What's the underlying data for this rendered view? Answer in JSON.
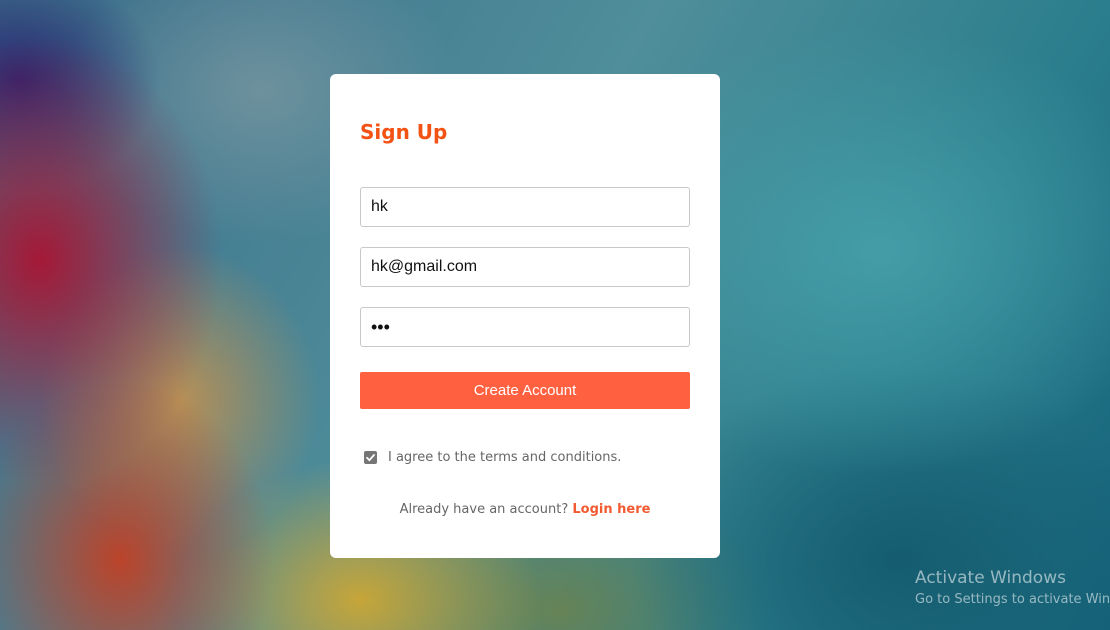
{
  "form": {
    "title": "Sign Up",
    "name_value": "hk",
    "email_value": "hk@gmail.com",
    "password_value": "abc",
    "submit_label": "Create Account",
    "terms_label": "I agree to the terms and conditions.",
    "terms_checked": true,
    "footer_text": "Already have an account?",
    "login_link": "Login here"
  },
  "watermark": {
    "title": "Activate Windows",
    "subtitle": "Go to Settings to activate Windows."
  },
  "colors": {
    "accent": "#f25314",
    "button": "#ff6040",
    "link": "#f25a32"
  },
  "icons": {
    "checkbox": "check-icon"
  }
}
